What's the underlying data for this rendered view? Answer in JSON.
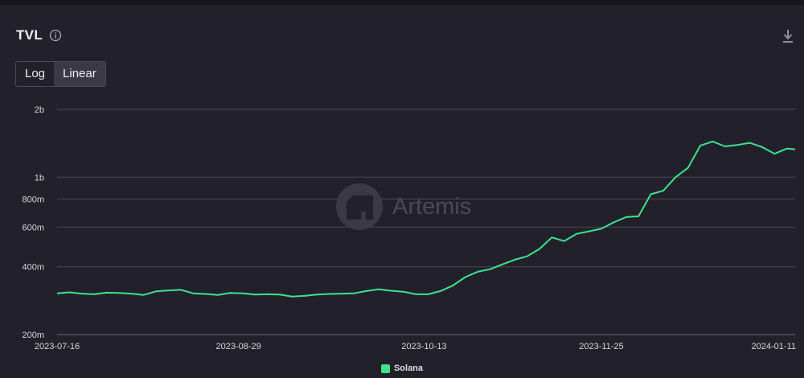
{
  "header": {
    "title": "TVL"
  },
  "icons": {
    "info": "info-icon",
    "download": "download-icon"
  },
  "scale_toggle": {
    "options": [
      "Log",
      "Linear"
    ],
    "active": "Log"
  },
  "watermark": {
    "text": "Artemis"
  },
  "colors": {
    "background": "#22212b",
    "series": "#3fe28d",
    "grid": "#4a4957",
    "axis_text": "#d6d6dc"
  },
  "chart_data": {
    "type": "line",
    "title": "TVL",
    "xlabel": "",
    "ylabel": "",
    "y_scale": "log",
    "ylim": [
      200000000,
      2000000000
    ],
    "y_ticks": [
      {
        "value": 200000000,
        "label": "200m"
      },
      {
        "value": 400000000,
        "label": "400m"
      },
      {
        "value": 600000000,
        "label": "600m"
      },
      {
        "value": 800000000,
        "label": "800m"
      },
      {
        "value": 1000000000,
        "label": "1b"
      },
      {
        "value": 2000000000,
        "label": "2b"
      }
    ],
    "x_range": [
      "2023-07-16",
      "2024-01-11"
    ],
    "x_ticks": [
      "2023-07-16",
      "2023-08-29",
      "2023-10-13",
      "2023-11-25",
      "2024-01-11"
    ],
    "legend_position": "bottom-center",
    "grid": true,
    "series": [
      {
        "name": "Solana",
        "color": "#3fe28d",
        "points": [
          [
            "2023-07-16",
            305000000
          ],
          [
            "2023-07-19",
            308000000
          ],
          [
            "2023-07-22",
            304000000
          ],
          [
            "2023-07-25",
            302000000
          ],
          [
            "2023-07-28",
            307000000
          ],
          [
            "2023-07-31",
            306000000
          ],
          [
            "2023-08-03",
            304000000
          ],
          [
            "2023-08-06",
            300000000
          ],
          [
            "2023-08-09",
            311000000
          ],
          [
            "2023-08-12",
            314000000
          ],
          [
            "2023-08-15",
            316000000
          ],
          [
            "2023-08-18",
            305000000
          ],
          [
            "2023-08-21",
            303000000
          ],
          [
            "2023-08-24",
            300000000
          ],
          [
            "2023-08-27",
            306000000
          ],
          [
            "2023-08-30",
            305000000
          ],
          [
            "2023-09-02",
            301000000
          ],
          [
            "2023-09-05",
            302000000
          ],
          [
            "2023-09-08",
            301000000
          ],
          [
            "2023-09-11",
            295000000
          ],
          [
            "2023-09-14",
            297000000
          ],
          [
            "2023-09-17",
            301000000
          ],
          [
            "2023-09-20",
            303000000
          ],
          [
            "2023-09-23",
            304000000
          ],
          [
            "2023-09-26",
            305000000
          ],
          [
            "2023-09-29",
            312000000
          ],
          [
            "2023-10-02",
            318000000
          ],
          [
            "2023-10-05",
            313000000
          ],
          [
            "2023-10-08",
            310000000
          ],
          [
            "2023-10-11",
            302000000
          ],
          [
            "2023-10-14",
            302000000
          ],
          [
            "2023-10-17",
            312000000
          ],
          [
            "2023-10-20",
            330000000
          ],
          [
            "2023-10-23",
            360000000
          ],
          [
            "2023-10-26",
            380000000
          ],
          [
            "2023-10-29",
            390000000
          ],
          [
            "2023-11-01",
            410000000
          ],
          [
            "2023-11-04",
            430000000
          ],
          [
            "2023-11-07",
            445000000
          ],
          [
            "2023-11-10",
            480000000
          ],
          [
            "2023-11-13",
            540000000
          ],
          [
            "2023-11-16",
            520000000
          ],
          [
            "2023-11-19",
            560000000
          ],
          [
            "2023-11-22",
            575000000
          ],
          [
            "2023-11-25",
            590000000
          ],
          [
            "2023-11-28",
            630000000
          ],
          [
            "2023-12-01",
            665000000
          ],
          [
            "2023-12-04",
            670000000
          ],
          [
            "2023-12-07",
            840000000
          ],
          [
            "2023-12-10",
            870000000
          ],
          [
            "2023-12-13",
            1000000000
          ],
          [
            "2023-12-16",
            1100000000
          ],
          [
            "2023-12-19",
            1380000000
          ],
          [
            "2023-12-22",
            1440000000
          ],
          [
            "2023-12-25",
            1370000000
          ],
          [
            "2023-12-28",
            1390000000
          ],
          [
            "2023-12-31",
            1420000000
          ],
          [
            "2024-01-03",
            1360000000
          ],
          [
            "2024-01-06",
            1270000000
          ],
          [
            "2024-01-09",
            1340000000
          ],
          [
            "2024-01-11",
            1330000000
          ]
        ]
      }
    ]
  }
}
